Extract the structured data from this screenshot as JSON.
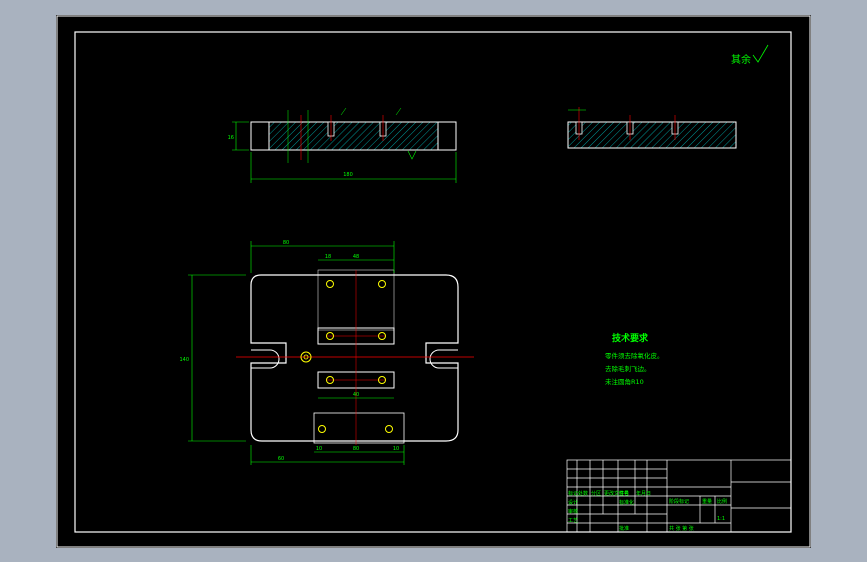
{
  "drawing": {
    "roughness_note": "其余",
    "technical_requirements": {
      "title": "技术要求",
      "items": [
        "零件须去除氧化皮。",
        "去除毛刺飞边。",
        "未注圆角R10"
      ]
    },
    "dimensions": {
      "front_overall_length": "180",
      "front_thickness": "16",
      "plan_overall_height": "140",
      "plan_top_width": "80",
      "plan_slot_span": "48",
      "plan_offset_left": "18",
      "plan_inner": "40",
      "plan_bottom_span": "60",
      "plan_bottom_width": "80",
      "plan_small_left": "10",
      "plan_small_right": "10"
    },
    "title_block": {
      "labels_left": [
        "标记",
        "处数",
        "分区",
        "更改文件号",
        "签名",
        "年月日"
      ],
      "row_design": "设计",
      "row_standard": "标准化",
      "row_check": "审核",
      "row_process": "工艺",
      "row_approve": "批准",
      "stage_label": "阶段标记",
      "weight_label": "重量",
      "scale_label": "比例",
      "scale_value": "1:1",
      "sheet_label": "共 张 第 张"
    }
  },
  "colors": {
    "background_window": "#a9b2bf",
    "paper": "#000000",
    "border": "#ffffff",
    "geometry": "#ffffff",
    "dimension": "#00ff00",
    "hatch": "#00ffff",
    "center_line": "#ff0000",
    "hole": "#ffff00"
  }
}
